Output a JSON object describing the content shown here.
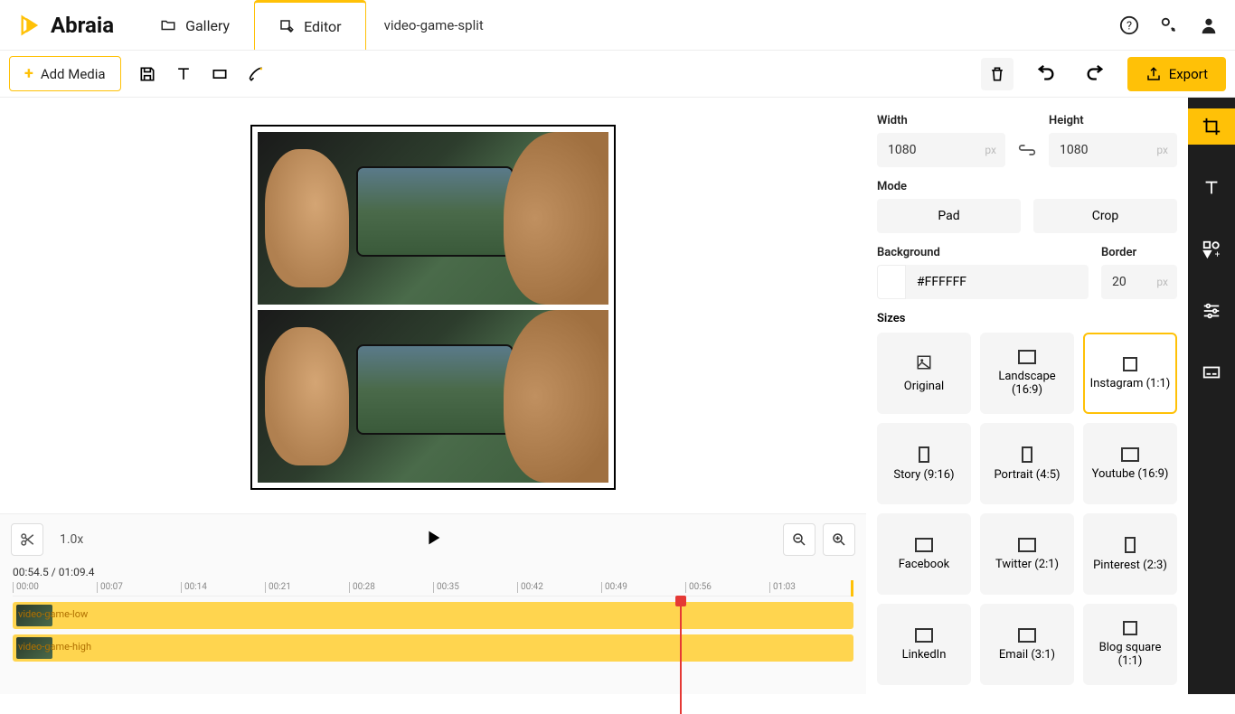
{
  "brand": "Abraia",
  "tabs": {
    "gallery": "Gallery",
    "editor": "Editor"
  },
  "filename": "video-game-split",
  "toolbar": {
    "add_media": "Add Media",
    "export": "Export"
  },
  "panel": {
    "width_label": "Width",
    "width_value": "1080",
    "height_label": "Height",
    "height_value": "1080",
    "unit": "px",
    "mode_label": "Mode",
    "mode_pad": "Pad",
    "mode_crop": "Crop",
    "background_label": "Background",
    "background_value": "#FFFFFF",
    "border_label": "Border",
    "border_value": "20",
    "sizes_label": "Sizes",
    "sizes": [
      "Original",
      "Landscape (16:9)",
      "Instagram (1:1)",
      "Story (9:16)",
      "Portrait (4:5)",
      "Youtube (16:9)",
      "Facebook",
      "Twitter (2:1)",
      "Pinterest (2:3)",
      "LinkedIn",
      "Email (3:1)",
      "Blog square (1:1)"
    ],
    "active_size_index": 2
  },
  "timeline": {
    "speed": "1.0x",
    "timecode": "00:54.5 / 01:09.4",
    "ticks": [
      "00:00",
      "00:07",
      "00:14",
      "00:21",
      "00:28",
      "00:35",
      "00:42",
      "00:49",
      "00:56",
      "01:03"
    ],
    "playhead_percent": 78.5,
    "tracks": [
      {
        "label": "video-game-low"
      },
      {
        "label": "video-game-high"
      }
    ]
  }
}
